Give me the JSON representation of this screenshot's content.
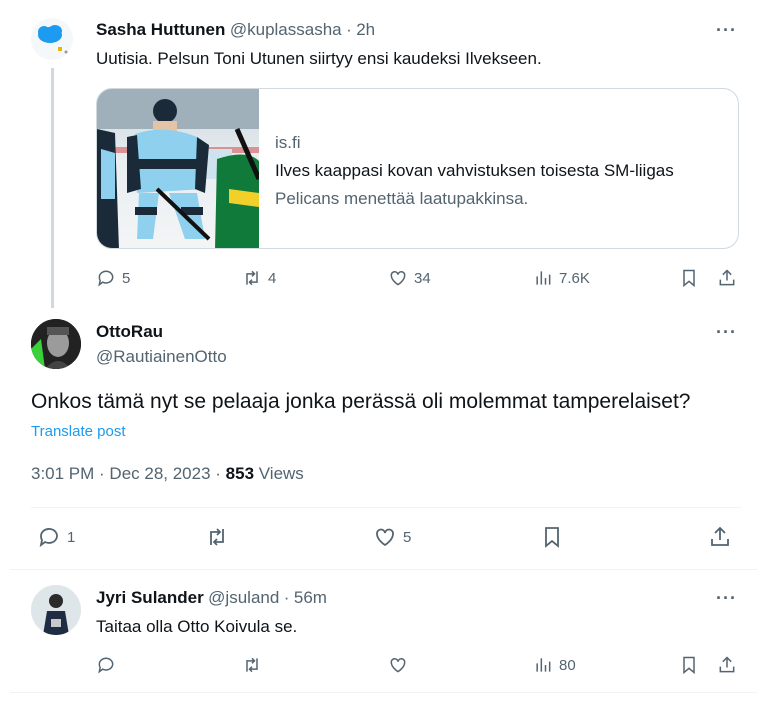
{
  "tweet1": {
    "name": "Sasha Huttunen",
    "handle": "@kuplassasha",
    "dot": "·",
    "time": "2h",
    "more": "···",
    "text": "Uutisia. Pelsun Toni Utunen siirtyy ensi kaudeksi Ilvekseen.",
    "card": {
      "domain": "is.fi",
      "title": "Ilves kaappasi kovan vahvistuksen toisesta SM-liigas",
      "description": "Pelicans menettää laatupakkinsa."
    },
    "actions": {
      "replies": "5",
      "reposts": "4",
      "likes": "34",
      "views": "7.6K"
    }
  },
  "main": {
    "name": "OttoRau",
    "handle": "@RautiainenOtto",
    "more": "···",
    "text": "Onkos tämä nyt se pelaaja jonka perässä oli molemmat tamperelaiset?",
    "translate": "Translate post",
    "time": "3:01 PM · Dec 28, 2023 · ",
    "views_count": "853",
    "views_label": " Views",
    "actions": {
      "replies": "1",
      "likes": "5"
    }
  },
  "tweet3": {
    "name": "Jyri Sulander",
    "handle": "@jsuland",
    "dot": "·",
    "time": "56m",
    "more": "···",
    "text": "Taitaa olla Otto Koivula se.",
    "actions": {
      "views": "80"
    }
  }
}
